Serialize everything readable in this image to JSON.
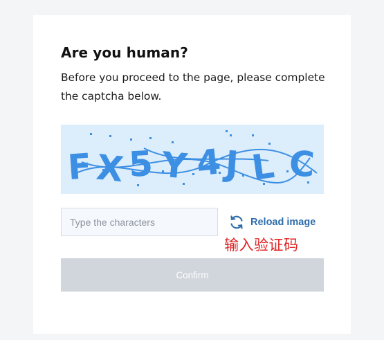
{
  "card": {
    "title": "Are you human?",
    "description": "Before you proceed to the page, please complete the captcha below."
  },
  "captcha": {
    "characters": [
      "F",
      "X",
      "5",
      "Y",
      "4",
      "J",
      "L",
      "C"
    ],
    "text_color": "#3d8fe3",
    "background_color": "#dcedfb"
  },
  "form": {
    "input_placeholder": "Type the characters",
    "input_value": "",
    "reload_label": "Reload image",
    "reload_icon": "refresh-icon",
    "confirm_label": "Confirm",
    "confirm_enabled": false
  },
  "annotation": {
    "text": "输入验证码",
    "color": "#e02424"
  }
}
